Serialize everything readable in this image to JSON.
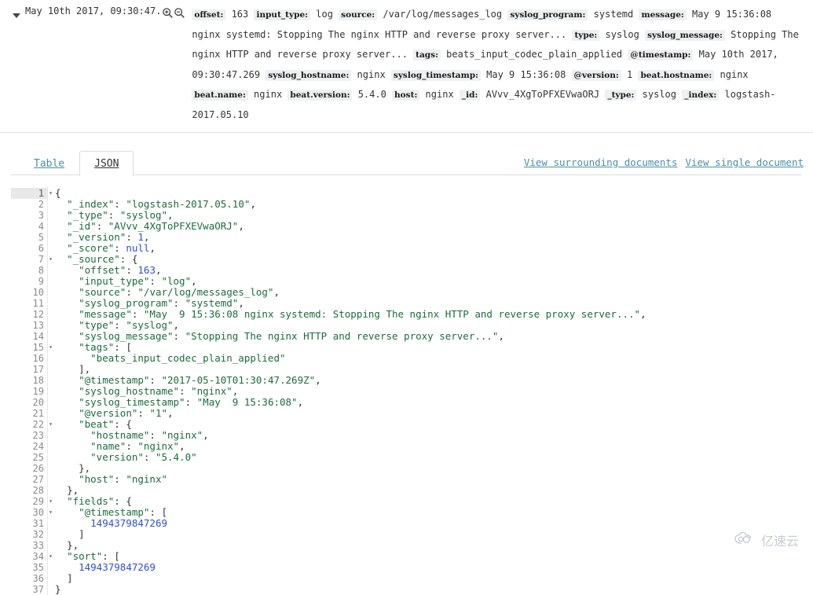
{
  "header": {
    "expand_toggle_icon": "caret-down-icon",
    "timestamp": "May 10th 2017, 09:30:47.",
    "zoom_in_icon": "magnifier-plus-icon",
    "zoom_out_icon": "magnifier-minus-icon",
    "fields": [
      {
        "key": "offset",
        "value": "163"
      },
      {
        "key": "input_type",
        "value": "log"
      },
      {
        "key": "source",
        "value": "/var/log/messages_log"
      },
      {
        "key": "syslog_program",
        "value": "systemd"
      },
      {
        "key": "message",
        "value": "May 9 15:36:08 nginx systemd: Stopping The nginx HTTP and reverse proxy server..."
      },
      {
        "key": "type",
        "value": "syslog"
      },
      {
        "key": "syslog_message",
        "value": "Stopping The nginx HTTP and reverse proxy server..."
      },
      {
        "key": "tags",
        "value": "beats_input_codec_plain_applied"
      },
      {
        "key": "@timestamp",
        "value": "May 10th 2017, 09:30:47.269"
      },
      {
        "key": "syslog_hostname",
        "value": "nginx"
      },
      {
        "key": "syslog_timestamp",
        "value": "May 9 15:36:08"
      },
      {
        "key": "@version",
        "value": "1"
      },
      {
        "key": "beat.hostname",
        "value": "nginx"
      },
      {
        "key": "beat.name",
        "value": "nginx"
      },
      {
        "key": "beat.version",
        "value": "5.4.0"
      },
      {
        "key": "host",
        "value": "nginx"
      },
      {
        "key": "_id",
        "value": "AVvv_4XgToPFXEVwaORJ"
      },
      {
        "key": "_type",
        "value": "syslog"
      },
      {
        "key": "_index",
        "value": "logstash-2017.05.10"
      }
    ]
  },
  "tabs": [
    {
      "label": "Table",
      "active": false
    },
    {
      "label": "JSON",
      "active": true
    }
  ],
  "links": [
    {
      "label": "View surrounding documents"
    },
    {
      "label": "View single document"
    }
  ],
  "code": {
    "active_line": 1,
    "lines": [
      {
        "n": 1,
        "fold": true,
        "indent": 0,
        "tokens": [
          {
            "t": "pun",
            "v": "{"
          }
        ]
      },
      {
        "n": 2,
        "fold": false,
        "indent": 2,
        "tokens": [
          {
            "t": "key",
            "v": "\"_index\""
          },
          {
            "t": "pun",
            "v": ": "
          },
          {
            "t": "str",
            "v": "\"logstash-2017.05.10\""
          },
          {
            "t": "pun",
            "v": ","
          }
        ]
      },
      {
        "n": 3,
        "fold": false,
        "indent": 2,
        "tokens": [
          {
            "t": "key",
            "v": "\"_type\""
          },
          {
            "t": "pun",
            "v": ": "
          },
          {
            "t": "str",
            "v": "\"syslog\""
          },
          {
            "t": "pun",
            "v": ","
          }
        ]
      },
      {
        "n": 4,
        "fold": false,
        "indent": 2,
        "tokens": [
          {
            "t": "key",
            "v": "\"_id\""
          },
          {
            "t": "pun",
            "v": ": "
          },
          {
            "t": "str",
            "v": "\"AVvv_4XgToPFXEVwaORJ\""
          },
          {
            "t": "pun",
            "v": ","
          }
        ]
      },
      {
        "n": 5,
        "fold": false,
        "indent": 2,
        "tokens": [
          {
            "t": "key",
            "v": "\"_version\""
          },
          {
            "t": "pun",
            "v": ": "
          },
          {
            "t": "num",
            "v": "1"
          },
          {
            "t": "pun",
            "v": ","
          }
        ]
      },
      {
        "n": 6,
        "fold": false,
        "indent": 2,
        "tokens": [
          {
            "t": "key",
            "v": "\"_score\""
          },
          {
            "t": "pun",
            "v": ": "
          },
          {
            "t": "lit",
            "v": "null"
          },
          {
            "t": "pun",
            "v": ","
          }
        ]
      },
      {
        "n": 7,
        "fold": true,
        "indent": 2,
        "tokens": [
          {
            "t": "key",
            "v": "\"_source\""
          },
          {
            "t": "pun",
            "v": ": {"
          }
        ]
      },
      {
        "n": 8,
        "fold": false,
        "indent": 4,
        "tokens": [
          {
            "t": "key",
            "v": "\"offset\""
          },
          {
            "t": "pun",
            "v": ": "
          },
          {
            "t": "num",
            "v": "163"
          },
          {
            "t": "pun",
            "v": ","
          }
        ]
      },
      {
        "n": 9,
        "fold": false,
        "indent": 4,
        "tokens": [
          {
            "t": "key",
            "v": "\"input_type\""
          },
          {
            "t": "pun",
            "v": ": "
          },
          {
            "t": "str",
            "v": "\"log\""
          },
          {
            "t": "pun",
            "v": ","
          }
        ]
      },
      {
        "n": 10,
        "fold": false,
        "indent": 4,
        "tokens": [
          {
            "t": "key",
            "v": "\"source\""
          },
          {
            "t": "pun",
            "v": ": "
          },
          {
            "t": "str",
            "v": "\"/var/log/messages_log\""
          },
          {
            "t": "pun",
            "v": ","
          }
        ]
      },
      {
        "n": 11,
        "fold": false,
        "indent": 4,
        "tokens": [
          {
            "t": "key",
            "v": "\"syslog_program\""
          },
          {
            "t": "pun",
            "v": ": "
          },
          {
            "t": "str",
            "v": "\"systemd\""
          },
          {
            "t": "pun",
            "v": ","
          }
        ]
      },
      {
        "n": 12,
        "fold": false,
        "indent": 4,
        "tokens": [
          {
            "t": "key",
            "v": "\"message\""
          },
          {
            "t": "pun",
            "v": ": "
          },
          {
            "t": "str",
            "v": "\"May  9 15:36:08 nginx systemd: Stopping The nginx HTTP and reverse proxy server...\""
          },
          {
            "t": "pun",
            "v": ","
          }
        ]
      },
      {
        "n": 13,
        "fold": false,
        "indent": 4,
        "tokens": [
          {
            "t": "key",
            "v": "\"type\""
          },
          {
            "t": "pun",
            "v": ": "
          },
          {
            "t": "str",
            "v": "\"syslog\""
          },
          {
            "t": "pun",
            "v": ","
          }
        ]
      },
      {
        "n": 14,
        "fold": false,
        "indent": 4,
        "tokens": [
          {
            "t": "key",
            "v": "\"syslog_message\""
          },
          {
            "t": "pun",
            "v": ": "
          },
          {
            "t": "str",
            "v": "\"Stopping The nginx HTTP and reverse proxy server...\""
          },
          {
            "t": "pun",
            "v": ","
          }
        ]
      },
      {
        "n": 15,
        "fold": true,
        "indent": 4,
        "tokens": [
          {
            "t": "key",
            "v": "\"tags\""
          },
          {
            "t": "pun",
            "v": ": ["
          }
        ]
      },
      {
        "n": 16,
        "fold": false,
        "indent": 6,
        "tokens": [
          {
            "t": "str",
            "v": "\"beats_input_codec_plain_applied\""
          }
        ]
      },
      {
        "n": 17,
        "fold": false,
        "indent": 4,
        "tokens": [
          {
            "t": "pun",
            "v": "],"
          }
        ]
      },
      {
        "n": 18,
        "fold": false,
        "indent": 4,
        "tokens": [
          {
            "t": "key",
            "v": "\"@timestamp\""
          },
          {
            "t": "pun",
            "v": ": "
          },
          {
            "t": "str",
            "v": "\"2017-05-10T01:30:47.269Z\""
          },
          {
            "t": "pun",
            "v": ","
          }
        ]
      },
      {
        "n": 19,
        "fold": false,
        "indent": 4,
        "tokens": [
          {
            "t": "key",
            "v": "\"syslog_hostname\""
          },
          {
            "t": "pun",
            "v": ": "
          },
          {
            "t": "str",
            "v": "\"nginx\""
          },
          {
            "t": "pun",
            "v": ","
          }
        ]
      },
      {
        "n": 20,
        "fold": false,
        "indent": 4,
        "tokens": [
          {
            "t": "key",
            "v": "\"syslog_timestamp\""
          },
          {
            "t": "pun",
            "v": ": "
          },
          {
            "t": "str",
            "v": "\"May  9 15:36:08\""
          },
          {
            "t": "pun",
            "v": ","
          }
        ]
      },
      {
        "n": 21,
        "fold": false,
        "indent": 4,
        "tokens": [
          {
            "t": "key",
            "v": "\"@version\""
          },
          {
            "t": "pun",
            "v": ": "
          },
          {
            "t": "str",
            "v": "\"1\""
          },
          {
            "t": "pun",
            "v": ","
          }
        ]
      },
      {
        "n": 22,
        "fold": true,
        "indent": 4,
        "tokens": [
          {
            "t": "key",
            "v": "\"beat\""
          },
          {
            "t": "pun",
            "v": ": {"
          }
        ]
      },
      {
        "n": 23,
        "fold": false,
        "indent": 6,
        "tokens": [
          {
            "t": "key",
            "v": "\"hostname\""
          },
          {
            "t": "pun",
            "v": ": "
          },
          {
            "t": "str",
            "v": "\"nginx\""
          },
          {
            "t": "pun",
            "v": ","
          }
        ]
      },
      {
        "n": 24,
        "fold": false,
        "indent": 6,
        "tokens": [
          {
            "t": "key",
            "v": "\"name\""
          },
          {
            "t": "pun",
            "v": ": "
          },
          {
            "t": "str",
            "v": "\"nginx\""
          },
          {
            "t": "pun",
            "v": ","
          }
        ]
      },
      {
        "n": 25,
        "fold": false,
        "indent": 6,
        "tokens": [
          {
            "t": "key",
            "v": "\"version\""
          },
          {
            "t": "pun",
            "v": ": "
          },
          {
            "t": "str",
            "v": "\"5.4.0\""
          }
        ]
      },
      {
        "n": 26,
        "fold": false,
        "indent": 4,
        "tokens": [
          {
            "t": "pun",
            "v": "},"
          }
        ]
      },
      {
        "n": 27,
        "fold": false,
        "indent": 4,
        "tokens": [
          {
            "t": "key",
            "v": "\"host\""
          },
          {
            "t": "pun",
            "v": ": "
          },
          {
            "t": "str",
            "v": "\"nginx\""
          }
        ]
      },
      {
        "n": 28,
        "fold": false,
        "indent": 2,
        "tokens": [
          {
            "t": "pun",
            "v": "},"
          }
        ]
      },
      {
        "n": 29,
        "fold": true,
        "indent": 2,
        "tokens": [
          {
            "t": "key",
            "v": "\"fields\""
          },
          {
            "t": "pun",
            "v": ": {"
          }
        ]
      },
      {
        "n": 30,
        "fold": true,
        "indent": 4,
        "tokens": [
          {
            "t": "key",
            "v": "\"@timestamp\""
          },
          {
            "t": "pun",
            "v": ": ["
          }
        ]
      },
      {
        "n": 31,
        "fold": false,
        "indent": 6,
        "tokens": [
          {
            "t": "num",
            "v": "1494379847269"
          }
        ]
      },
      {
        "n": 32,
        "fold": false,
        "indent": 4,
        "tokens": [
          {
            "t": "pun",
            "v": "]"
          }
        ]
      },
      {
        "n": 33,
        "fold": false,
        "indent": 2,
        "tokens": [
          {
            "t": "pun",
            "v": "},"
          }
        ]
      },
      {
        "n": 34,
        "fold": true,
        "indent": 2,
        "tokens": [
          {
            "t": "key",
            "v": "\"sort\""
          },
          {
            "t": "pun",
            "v": ": ["
          }
        ]
      },
      {
        "n": 35,
        "fold": false,
        "indent": 4,
        "tokens": [
          {
            "t": "num",
            "v": "1494379847269"
          }
        ]
      },
      {
        "n": 36,
        "fold": false,
        "indent": 2,
        "tokens": [
          {
            "t": "pun",
            "v": "]"
          }
        ]
      },
      {
        "n": 37,
        "fold": false,
        "indent": 0,
        "tokens": [
          {
            "t": "pun",
            "v": "}"
          }
        ]
      }
    ]
  },
  "watermark": {
    "icon": "cloud-logo-icon",
    "text": "亿速云"
  },
  "colors": {
    "link": "#4a8fa8",
    "string": "#1c6b3c",
    "number": "#2d4ed8",
    "field_key_bg": "#eef0f2"
  }
}
